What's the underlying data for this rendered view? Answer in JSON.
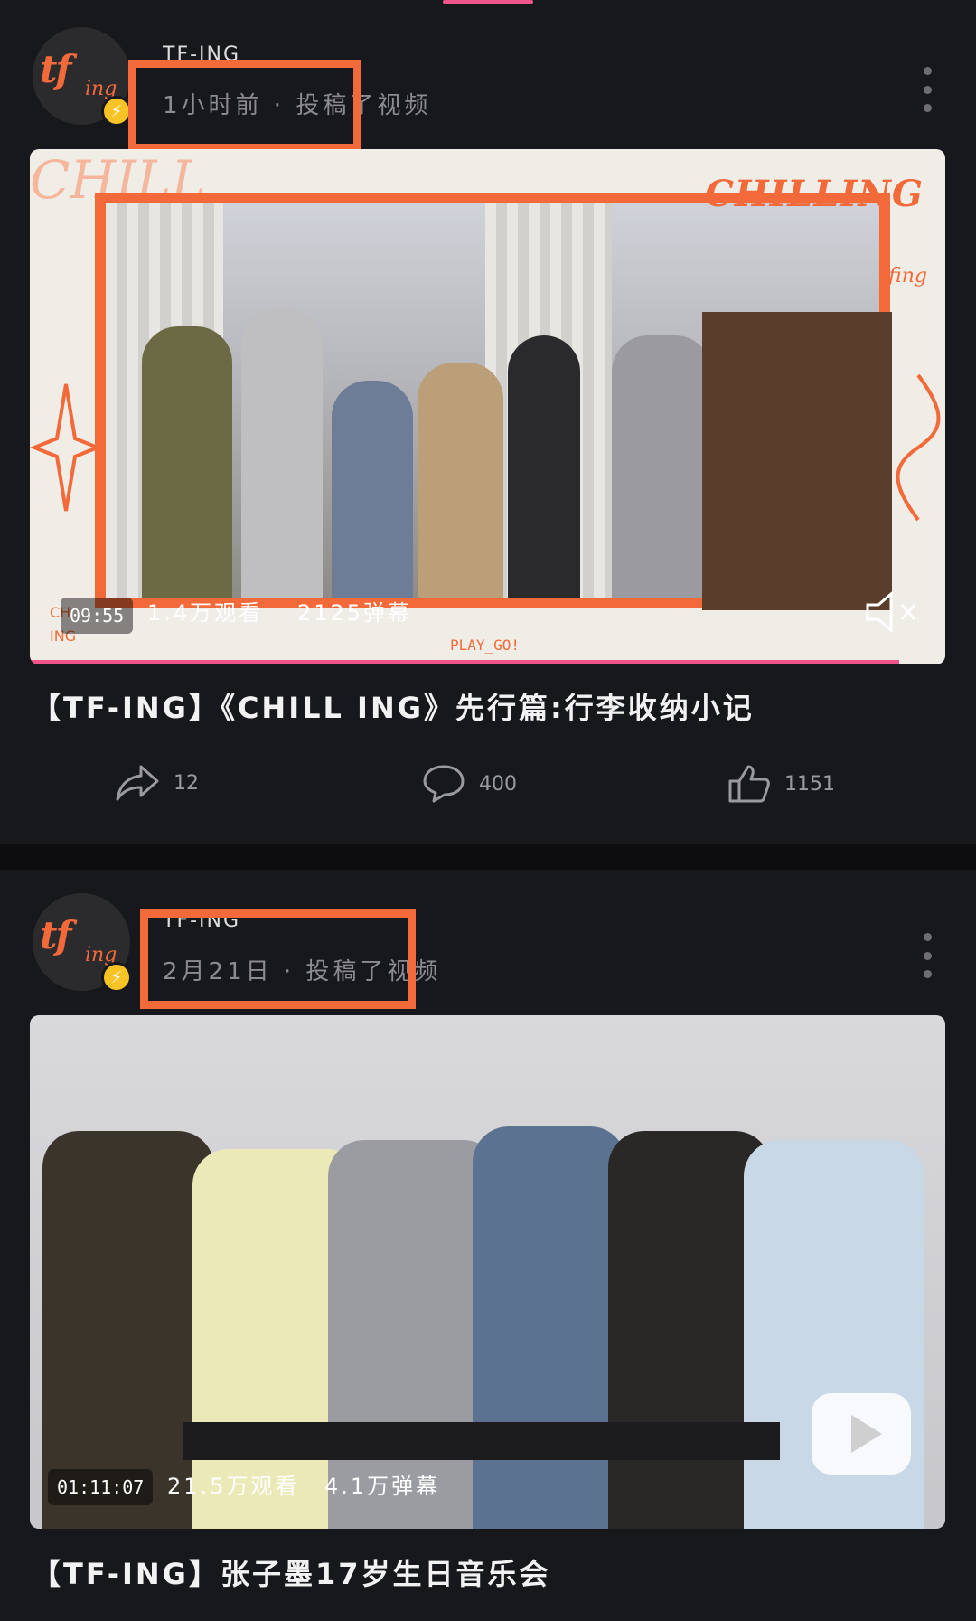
{
  "posts": [
    {
      "author": "TF-ING",
      "meta": "1小时前 · 投稿了视频",
      "thumbnail": {
        "overlay_title": "CHILLING",
        "overlay_tag": "tfing",
        "background_text": "CHILL",
        "corner_text": "CH ING",
        "play_text": "PLAY_GO!",
        "duration": "09:55",
        "views": "1.4万观看",
        "danmaku": "2125弹幕",
        "progress": 0.95,
        "muted": true
      },
      "title": "【TF-ING】《CHILL ING》先行篇:行李收纳小记",
      "actions": {
        "share_count": "12",
        "comment_count": "400",
        "like_count": "1151"
      }
    },
    {
      "author": "TF-ING",
      "meta": "2月21日 · 投稿了视频",
      "thumbnail": {
        "duration": "01:11:07",
        "views": "21.5万观看",
        "danmaku": "4.1万弹幕"
      },
      "title": "【TF-ING】张子墨17岁生日音乐会"
    }
  ],
  "colors": {
    "accent_orange": "#f26a3a",
    "accent_pink": "#f0548a",
    "badge_yellow": "#f7c325",
    "background": "#17181c"
  },
  "icons": {
    "share": "share-icon",
    "comment": "comment-icon",
    "like": "like-icon",
    "more": "more-vertical-icon",
    "mute": "mute-icon",
    "play": "play-icon"
  }
}
